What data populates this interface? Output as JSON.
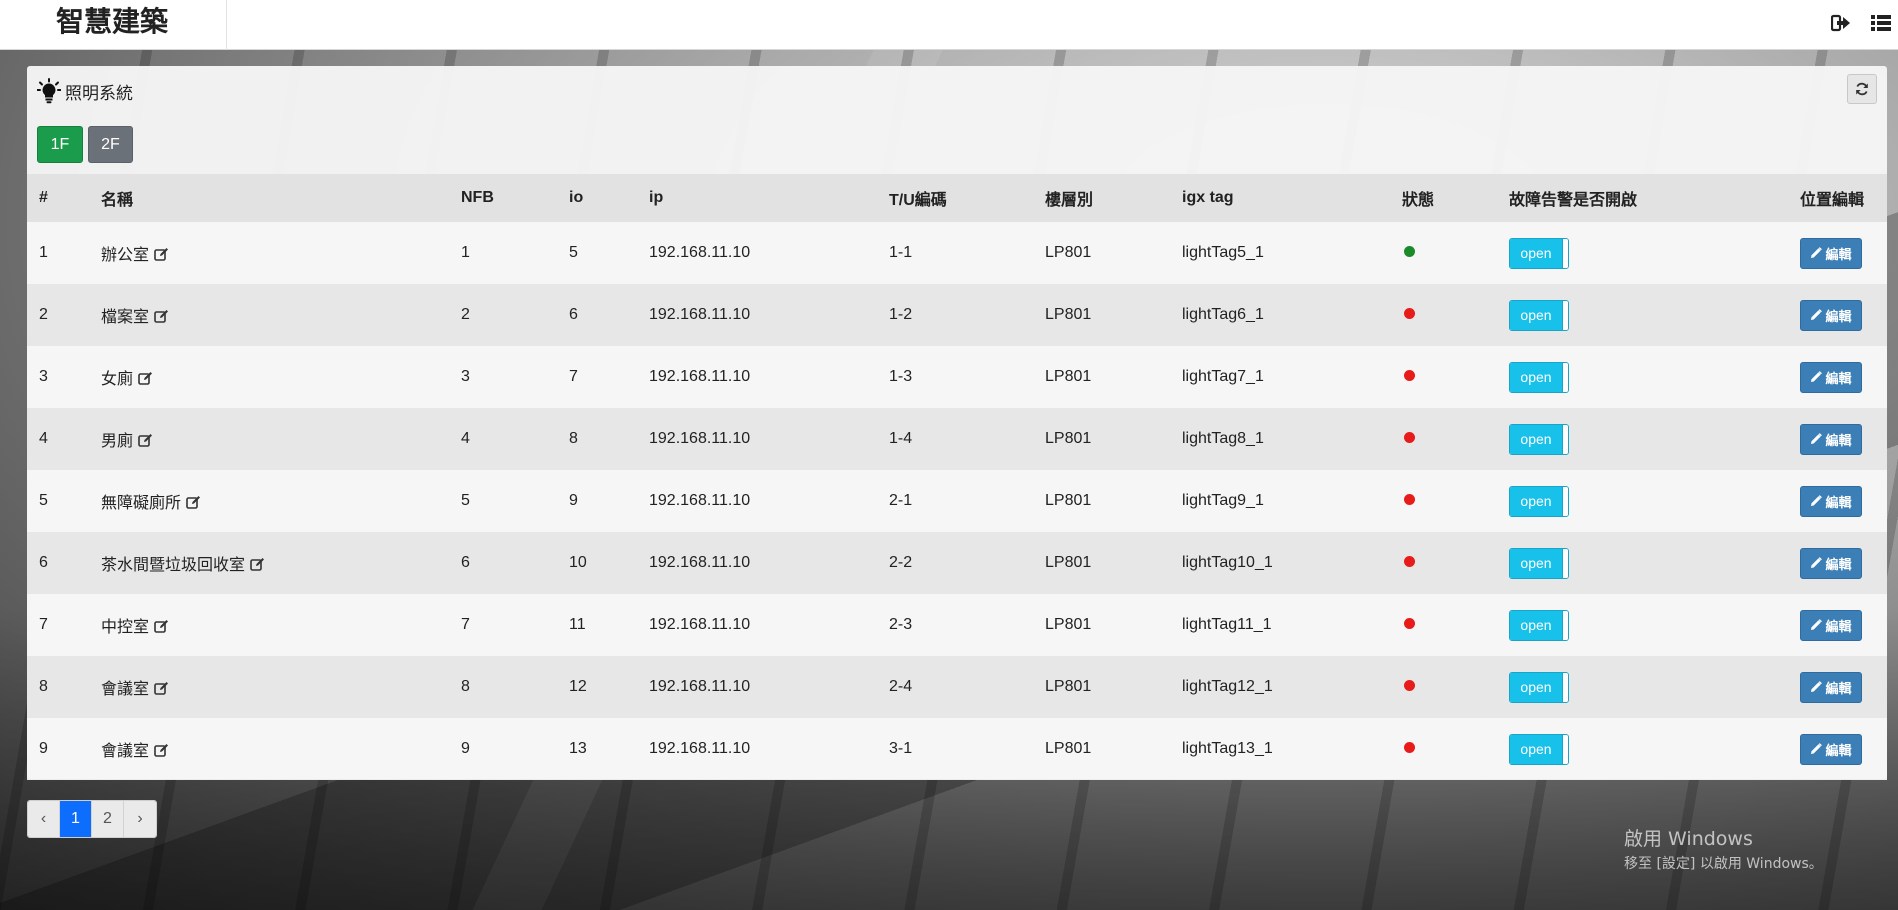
{
  "app": {
    "brand": "智慧建築"
  },
  "panel": {
    "title": "照明系統",
    "floors": [
      "1F",
      "2F"
    ],
    "active_floor": "1F"
  },
  "table": {
    "headers": {
      "idx": "#",
      "name": "名稱",
      "nfb": "NFB",
      "io": "io",
      "ip": "ip",
      "tu": "T/U編碼",
      "floor": "樓層別",
      "igx": "igx tag",
      "status": "狀態",
      "alarm": "故障告警是否開啟",
      "pos": "位置編輯"
    },
    "rows": [
      {
        "idx": "1",
        "name": "辦公室",
        "nfb": "1",
        "io": "5",
        "ip": "192.168.11.10",
        "tu": "1-1",
        "floor": "LP801",
        "igx": "lightTag5_1",
        "status": "on",
        "alarm": "open",
        "edit": "編輯"
      },
      {
        "idx": "2",
        "name": "檔案室",
        "nfb": "2",
        "io": "6",
        "ip": "192.168.11.10",
        "tu": "1-2",
        "floor": "LP801",
        "igx": "lightTag6_1",
        "status": "off",
        "alarm": "open",
        "edit": "編輯"
      },
      {
        "idx": "3",
        "name": "女廁",
        "nfb": "3",
        "io": "7",
        "ip": "192.168.11.10",
        "tu": "1-3",
        "floor": "LP801",
        "igx": "lightTag7_1",
        "status": "off",
        "alarm": "open",
        "edit": "編輯"
      },
      {
        "idx": "4",
        "name": "男廁",
        "nfb": "4",
        "io": "8",
        "ip": "192.168.11.10",
        "tu": "1-4",
        "floor": "LP801",
        "igx": "lightTag8_1",
        "status": "off",
        "alarm": "open",
        "edit": "編輯"
      },
      {
        "idx": "5",
        "name": "無障礙廁所",
        "nfb": "5",
        "io": "9",
        "ip": "192.168.11.10",
        "tu": "2-1",
        "floor": "LP801",
        "igx": "lightTag9_1",
        "status": "off",
        "alarm": "open",
        "edit": "編輯"
      },
      {
        "idx": "6",
        "name": "茶水間暨垃圾回收室",
        "nfb": "6",
        "io": "10",
        "ip": "192.168.11.10",
        "tu": "2-2",
        "floor": "LP801",
        "igx": "lightTag10_1",
        "status": "off",
        "alarm": "open",
        "edit": "編輯"
      },
      {
        "idx": "7",
        "name": "中控室",
        "nfb": "7",
        "io": "11",
        "ip": "192.168.11.10",
        "tu": "2-3",
        "floor": "LP801",
        "igx": "lightTag11_1",
        "status": "off",
        "alarm": "open",
        "edit": "編輯"
      },
      {
        "idx": "8",
        "name": "會議室",
        "nfb": "8",
        "io": "12",
        "ip": "192.168.11.10",
        "tu": "2-4",
        "floor": "LP801",
        "igx": "lightTag12_1",
        "status": "off",
        "alarm": "open",
        "edit": "編輯"
      },
      {
        "idx": "9",
        "name": "會議室",
        "nfb": "9",
        "io": "13",
        "ip": "192.168.11.10",
        "tu": "3-1",
        "floor": "LP801",
        "igx": "lightTag13_1",
        "status": "off",
        "alarm": "open",
        "edit": "編輯"
      }
    ]
  },
  "status_colors": {
    "on": "#1b8a2a",
    "off": "#e81b1b"
  },
  "pagination": {
    "prev": "‹",
    "pages": [
      "1",
      "2"
    ],
    "current": "1",
    "next": "›"
  },
  "watermark": {
    "line1": "啟用 Windows",
    "line2": "移至 [設定] 以啟用 Windows。"
  },
  "icons": {
    "logout": "sign-out-icon",
    "menu": "list-icon",
    "panel": "lightbulb-icon",
    "refresh": "refresh-icon",
    "name_edit": "edit-square-icon",
    "edit_button": "pencil-icon"
  }
}
